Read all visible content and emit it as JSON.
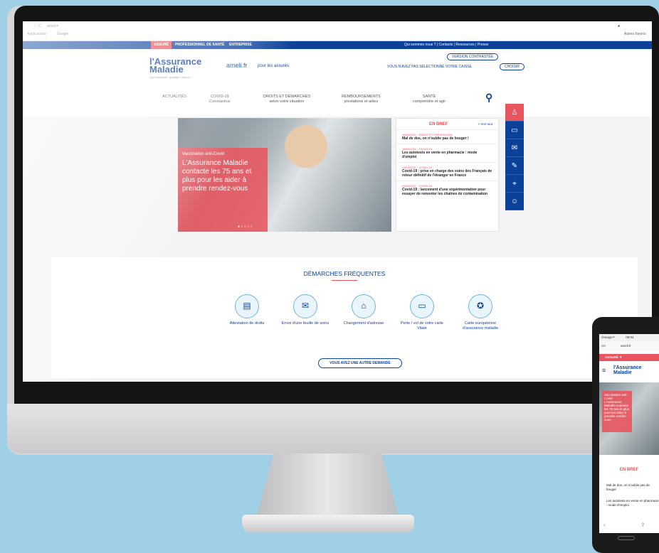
{
  "browser": {
    "url": "ameli.fr",
    "bookmarks": [
      "Applications",
      "Google"
    ],
    "other_bookmarks": "Autres favoris"
  },
  "topnav": {
    "tabs": [
      "ASSURÉ",
      "PROFESSIONNEL DE SANTÉ",
      "ENTREPRISE"
    ],
    "links": "Qui sommes nous ? | Contacts | Ressources | Presse"
  },
  "header": {
    "logo_line1": "l'Assurance",
    "logo_line2": "Maladie",
    "logo_tag": "Agir ensemble, protéger chacun",
    "ameli": "ameli.fr",
    "pour": "pour les assurés",
    "version_contrastee": "VERSION CONTRASTÉE",
    "caisse_text": "VOUS N'AVEZ PAS SÉLECTIONNÉ VOTRE CAISSE",
    "choisir": "CHOISIR"
  },
  "menu": [
    {
      "l1": "ACTUALITÉS",
      "l2": ""
    },
    {
      "l1": "COVID-19",
      "l2": "Coronavirus"
    },
    {
      "l1": "DROITS ET DÉMARCHES",
      "l2": "selon votre situation"
    },
    {
      "l1": "REMBOURSEMENTS",
      "l2": "prestations et aides"
    },
    {
      "l1": "SANTÉ",
      "l2": "comprendre et agir"
    }
  ],
  "hero": {
    "kicker": "Vaccination anti-Covid",
    "text": "L'Assurance Maladie contacte les 75 ans et plus pour les aider à prendre rendez-vous"
  },
  "brief": {
    "title": "EN BREF",
    "voir": "> Voir tout",
    "items": [
      {
        "date": "26/03/2021 · SANTÉ ET PRÉVENTION",
        "text": "Mal de dos, on n'oublie pas de bouger !"
      },
      {
        "date": "15/04/2021 · COVID-19",
        "text": "Les autotests en vente en pharmacie : mode d'emploi"
      },
      {
        "date": "13/04/2021 · COVID-19",
        "text": "Covid-19 : prise en charge des soins des Français de retour définitif de l'étranger en France"
      },
      {
        "date": "09/04/2021 · COVID-19",
        "text": "Covid-19 : lancement d'une expérimentation pour essayer de remonter les chaînes de contamination"
      }
    ]
  },
  "demarches": {
    "title": "DÉMARCHES FRÉQUENTES",
    "items": [
      "Attestation de droits",
      "Envoi d'une feuille de soins",
      "Changement d'adresse",
      "Perte / vol de votre carte Vitale",
      "Carte européenne d'assurance maladie"
    ],
    "button": "VOUS AVEZ UNE AUTRE DEMANDE"
  },
  "phone": {
    "carrier": "Orange F",
    "time": "09:04",
    "aa": "AA",
    "url": "ameli.fr",
    "assure": "ASSURÉ ▼",
    "logo": "l'Assurance Maladie",
    "hero": "Vaccination anti-Covid L'Assurance Maladie contacte les 75 ans et plus pour les aider à prendre rendez-vous",
    "brief": "EN BREF",
    "item1": "Mal de dos, on n'oublie pas de bouger",
    "item2": "Les autotests en vente en pharmacie : mode d'emploi"
  },
  "colors": {
    "brand": "#0c419a",
    "accent": "#e8555e",
    "background": "#9fd0e6"
  }
}
